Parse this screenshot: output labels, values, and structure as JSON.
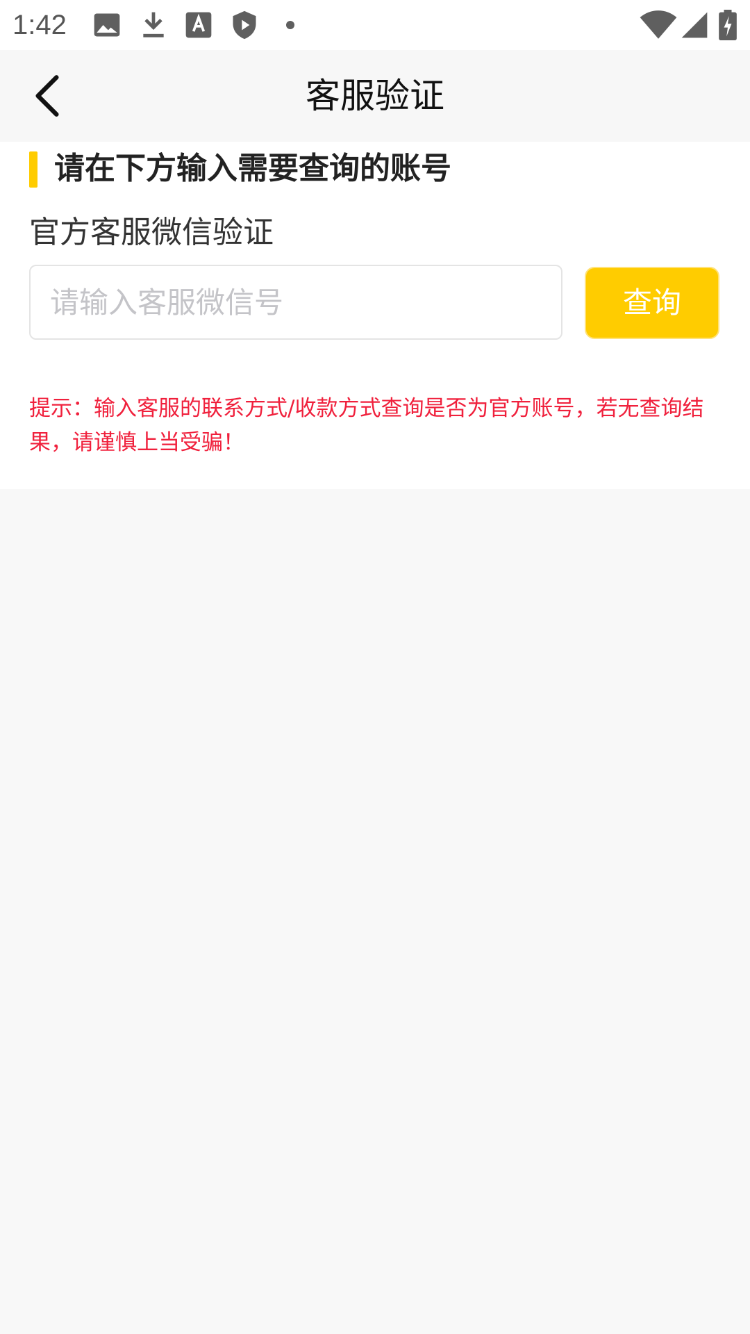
{
  "status_bar": {
    "time": "1:42",
    "icons_left": [
      "image-icon",
      "download-icon",
      "text-a-icon",
      "shield-play-icon",
      "dot-icon"
    ],
    "icons_right": [
      "wifi-icon",
      "cell-signal-icon",
      "battery-charging-icon"
    ]
  },
  "header": {
    "title": "客服验证",
    "back_icon": "chevron-left-icon"
  },
  "main": {
    "section_title": "请在下方输入需要查询的账号",
    "field_label": "官方客服微信验证",
    "input_value": "",
    "input_placeholder": "请输入客服微信号",
    "query_button": "查询",
    "tip": "提示：输入客服的联系方式/收款方式查询是否为官方账号，若无查询结果，请谨慎上当受骗！"
  },
  "colors": {
    "accent": "#ffcc00",
    "warning_text": "#f0203c",
    "page_background": "#f8f8f8"
  }
}
